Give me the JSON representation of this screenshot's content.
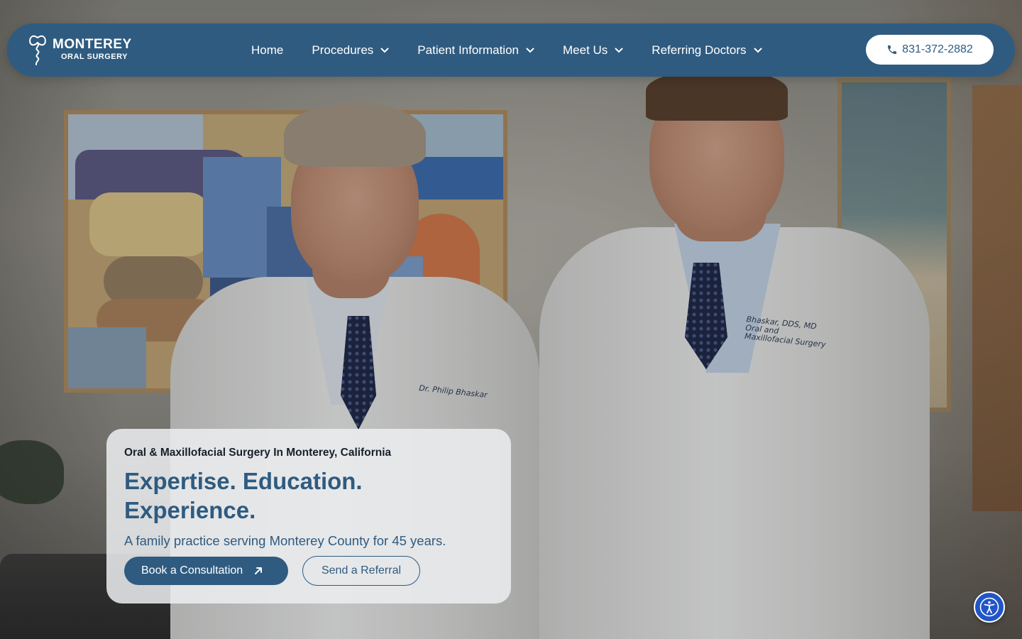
{
  "brand": {
    "name_line1": "MONTEREY",
    "name_line2": "ORAL SURGERY",
    "logo_icon": "tooth-logo-icon"
  },
  "nav": {
    "items": [
      {
        "label": "Home",
        "has_dropdown": false
      },
      {
        "label": "Procedures",
        "has_dropdown": true
      },
      {
        "label": "Patient Information",
        "has_dropdown": true
      },
      {
        "label": "Meet Us",
        "has_dropdown": true
      },
      {
        "label": "Referring Doctors",
        "has_dropdown": true
      }
    ],
    "phone": "831-372-2882",
    "phone_icon": "phone-icon"
  },
  "hero": {
    "eyebrow": "Oral & Maxillofacial Surgery In Monterey, California",
    "headline": "Expertise. Education. Experience.",
    "subtext": "A family practice serving Monterey County for 45 years.",
    "primary_cta": "Book a Consultation",
    "primary_cta_icon": "arrow-up-right-icon",
    "secondary_cta": "Send a Referral"
  },
  "photo": {
    "coat_name_left": "Dr. Philip Bhaskar",
    "coat_name_right_line1": "Bhaskar, DDS, MD",
    "coat_name_right_line2": "Oral and",
    "coat_name_right_line3": "Maxillofacial Surgery"
  },
  "accessibility": {
    "icon": "accessibility-icon"
  },
  "colors": {
    "brand_blue": "#2f5b80",
    "accessibility_blue": "#2155c8",
    "card_bg": "#eceef0"
  }
}
